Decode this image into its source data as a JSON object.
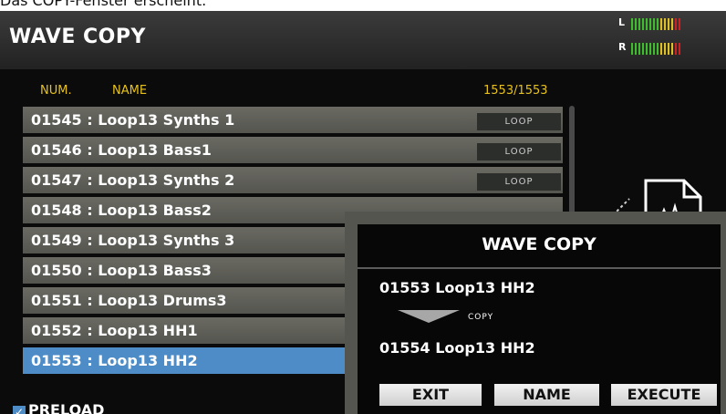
{
  "caption": "Das COPY-Fenster erscheint.",
  "header": {
    "title": "WAVE COPY"
  },
  "meters": {
    "left_label": "L",
    "right_label": "R",
    "colors": {
      "low": "#3dbf2b",
      "mid": "#e0c020",
      "high": "#d02020"
    }
  },
  "list": {
    "col_num": "NUM.",
    "col_name": "NAME",
    "count": "1553/1553",
    "rows": [
      {
        "label": "01545 : Loop13 Synths 1",
        "tag": "LOOP"
      },
      {
        "label": "01546 : Loop13 Bass1",
        "tag": "LOOP"
      },
      {
        "label": "01547 : Loop13 Synths 2",
        "tag": "LOOP"
      },
      {
        "label": "01548 : Loop13 Bass2",
        "tag": ""
      },
      {
        "label": "01549 : Loop13 Synths 3",
        "tag": ""
      },
      {
        "label": "01550 : Loop13 Bass3",
        "tag": ""
      },
      {
        "label": "01551 : Loop13 Drums3",
        "tag": ""
      },
      {
        "label": "01552 : Loop13 HH1",
        "tag": ""
      },
      {
        "label": "01553 : Loop13 HH2",
        "tag": ""
      }
    ],
    "selected_index": 8
  },
  "preload": {
    "label": "PRELOAD",
    "checked": true
  },
  "dialog": {
    "title": "WAVE COPY",
    "source": "01553 Loop13 HH2",
    "arrow_label": "COPY",
    "destination": "01554 Loop13 HH2",
    "buttons": {
      "exit": "EXIT",
      "name": "NAME",
      "execute": "EXECUTE"
    }
  },
  "colors": {
    "accent_header": "#e7c21c",
    "selection": "#4d8cc7",
    "row_bg": "#5f5f59",
    "dialog_frame": "#55554f"
  }
}
